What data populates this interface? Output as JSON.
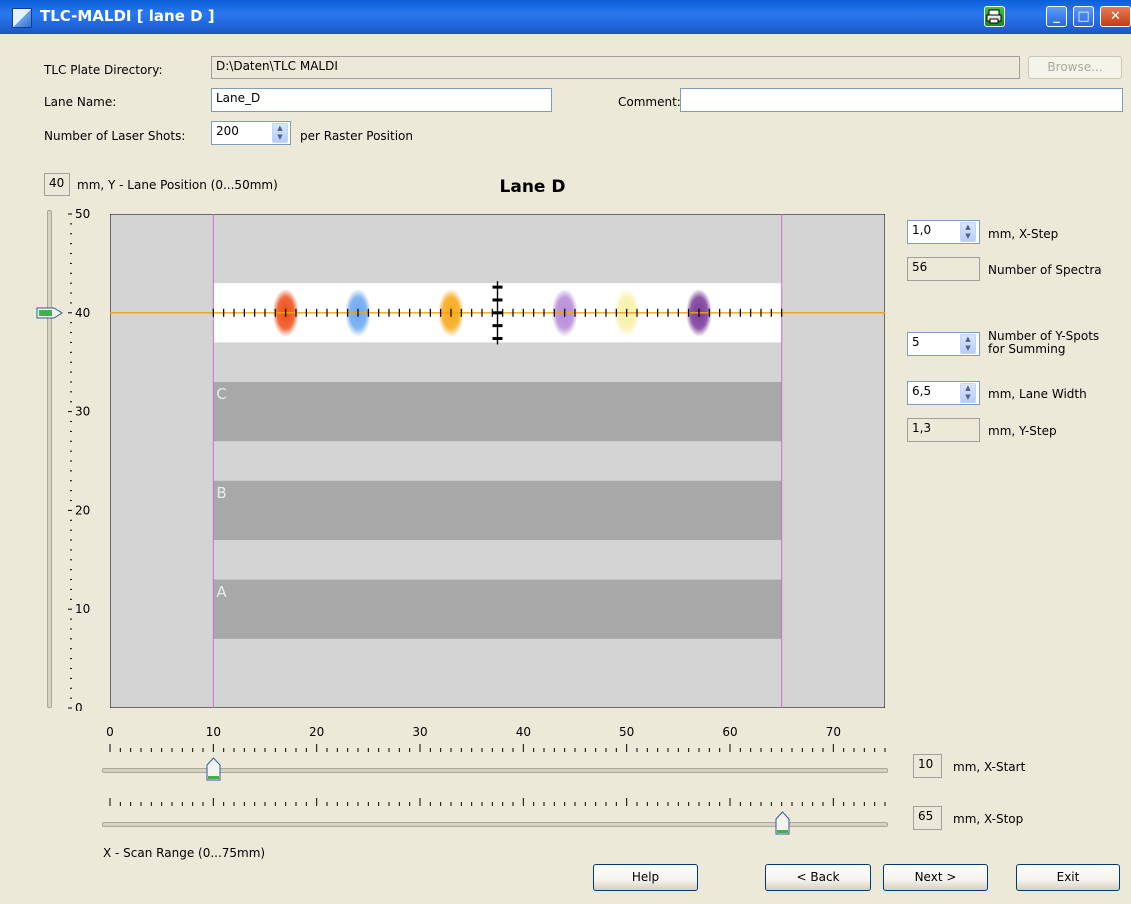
{
  "window": {
    "title": "TLC-MALDI  [ lane D ]",
    "icons": [
      "app-icon",
      "printer-icon",
      "minimize-icon",
      "maximize-icon",
      "close-icon"
    ]
  },
  "form": {
    "plate_dir_label": "TLC Plate Directory:",
    "plate_dir_value": "D:\\Daten\\TLC MALDI",
    "browse_label": "Browse...",
    "lane_name_label": "Lane Name:",
    "lane_name_value": "Lane_D",
    "comment_label": "Comment:",
    "comment_value": "",
    "laser_shots_label": "Number of Laser Shots:",
    "laser_shots_value": "200",
    "laser_shots_suffix": "per Raster Position"
  },
  "y_position": {
    "value": "40",
    "label": "mm, Y - Lane Position (0...50mm)"
  },
  "plot": {
    "title": "Lane D",
    "y_ticks": [
      "50",
      "40",
      "30",
      "20",
      "10",
      "0"
    ],
    "x_ticks": [
      "0",
      "10",
      "20",
      "30",
      "40",
      "50",
      "60",
      "70"
    ],
    "lane_labels": [
      "C",
      "B",
      "A"
    ],
    "y_current": 40,
    "x_start": 10,
    "x_stop": 65,
    "x_max": 75,
    "y_max": 50,
    "spots": [
      {
        "x": 17,
        "color": "#ee4e18"
      },
      {
        "x": 24,
        "color": "#6aa8f0"
      },
      {
        "x": 33,
        "color": "#f7a818"
      },
      {
        "x": 44,
        "color": "#b58ad8"
      },
      {
        "x": 50,
        "color": "#f7f0a8"
      },
      {
        "x": 57,
        "color": "#7a3a98"
      }
    ],
    "colors": {
      "background": "#d4d4d4",
      "lane": "#a8a8a8",
      "active": "#ffffff",
      "scanline": "#f2a20c",
      "bounds": "#d26ad2"
    }
  },
  "right_panel": {
    "x_step_value": "1,0",
    "x_step_label": "mm, X-Step",
    "num_spectra_value": "56",
    "num_spectra_label": "Number of Spectra",
    "y_spots_value": "5",
    "y_spots_label_1": "Number of Y-Spots",
    "y_spots_label_2": "for Summing",
    "lane_width_value": "6,5",
    "lane_width_label": "mm, Lane Width",
    "y_step_value": "1,3",
    "y_step_label": "mm, Y-Step"
  },
  "x_range": {
    "start_value": "10",
    "start_label": "mm, X-Start",
    "stop_value": "65",
    "stop_label": "mm, X-Stop",
    "caption": "X - Scan Range (0...75mm)"
  },
  "buttons": {
    "help": "Help",
    "back": "< Back",
    "next": "Next >",
    "exit": "Exit"
  }
}
